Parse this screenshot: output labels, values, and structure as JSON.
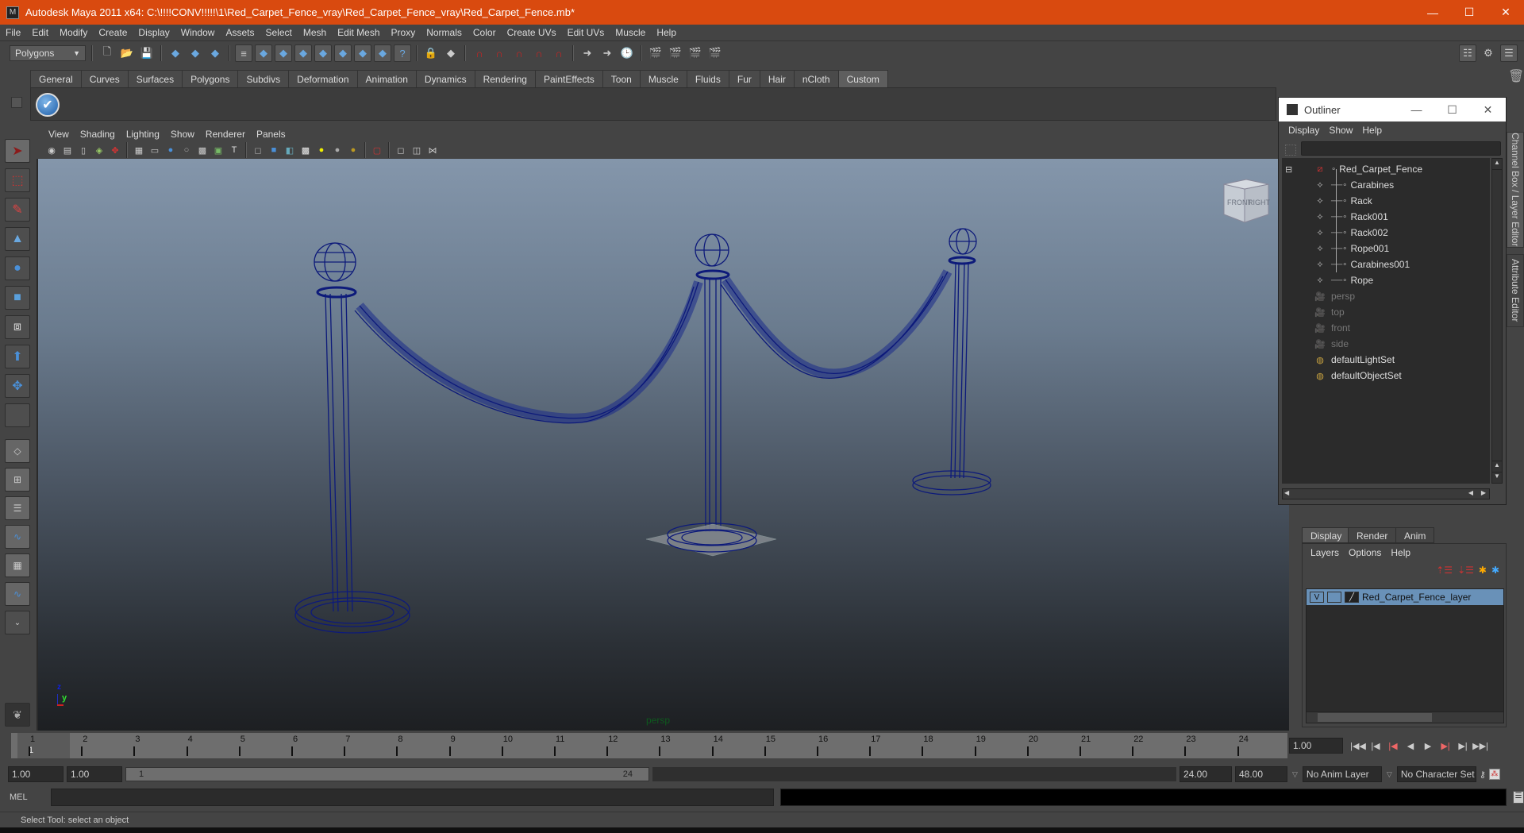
{
  "window": {
    "title": "Autodesk Maya 2011 x64: C:\\!!!!CONV!!!!!\\1\\Red_Carpet_Fence_vray\\Red_Carpet_Fence_vray\\Red_Carpet_Fence.mb*",
    "app_icon": "maya-icon",
    "controls": {
      "minimize": "—",
      "maximize": "☐",
      "close": "✕"
    },
    "title_bar_color": "#d94a0f"
  },
  "menubar": [
    "File",
    "Edit",
    "Modify",
    "Create",
    "Display",
    "Window",
    "Assets",
    "Select",
    "Mesh",
    "Edit Mesh",
    "Proxy",
    "Normals",
    "Color",
    "Create UVs",
    "Edit UVs",
    "Muscle",
    "Help"
  ],
  "statusline": {
    "menu_set": "Polygons",
    "icons": [
      "new-scene-icon",
      "open-scene-icon",
      "save-scene-icon",
      "select-by-hierarchy-icon",
      "select-by-object-icon",
      "select-by-component-icon",
      "mask-menu-icon",
      "select-handles-icon",
      "select-joints-icon",
      "select-curves-icon",
      "select-surfaces-icon",
      "select-deformers-icon",
      "select-dynamics-icon",
      "select-rendering-icon",
      "select-misc-icon",
      "lock-selection-icon",
      "highlight-selection-icon",
      "snap-grid-icon",
      "snap-curve-icon",
      "snap-point-icon",
      "snap-view-plane-icon",
      "snap-live-icon",
      "input-ops-icon",
      "output-ops-icon",
      "construction-history-icon",
      "render-view-icon",
      "render-current-icon",
      "ipr-render-icon",
      "render-settings-icon"
    ],
    "right_icons": [
      "channel-box-toggle-icon",
      "tool-settings-icon",
      "attribute-editor-icon"
    ]
  },
  "shelf": {
    "tabs": [
      "General",
      "Curves",
      "Surfaces",
      "Polygons",
      "Subdivs",
      "Deformation",
      "Animation",
      "Dynamics",
      "Rendering",
      "PaintEffects",
      "Toon",
      "Muscle",
      "Fluids",
      "Fur",
      "Hair",
      "nCloth",
      "Custom"
    ],
    "active_tab": "Custom",
    "items": [
      "checkmark-shelf-icon"
    ],
    "trash_icon": "trash-icon"
  },
  "toolbox": {
    "tools": [
      "select-tool-icon",
      "lasso-tool-icon",
      "paint-select-tool-icon",
      "move-tool-icon",
      "rotate-tool-icon",
      "scale-tool-icon",
      "universal-manipulator-icon",
      "soft-modification-icon",
      "show-manipulator-icon",
      "last-tool-slot"
    ],
    "layouts": [
      "single-perspective-layout-icon",
      "four-view-layout-icon",
      "outliner-persp-layout-icon",
      "persp-graph-layout-icon",
      "hypershade-persp-layout-icon",
      "persp-outliner-graph-layout-icon",
      "more-layouts-icon"
    ],
    "bottom_icon": "maya-logo-icon"
  },
  "viewport": {
    "menu": [
      "View",
      "Shading",
      "Lighting",
      "Show",
      "Renderer",
      "Panels"
    ],
    "icons": [
      "select-camera-icon",
      "camera-attributes-icon",
      "bookmarks-icon",
      "image-plane-icon",
      "two-d-pan-zoom-icon",
      "grid-icon",
      "film-gate-icon",
      "resolution-gate-icon",
      "gate-mask-icon",
      "field-chart-icon",
      "safe-action-icon",
      "safe-title-icon",
      "wireframe-icon",
      "smooth-shade-icon",
      "wireframe-on-shaded-icon",
      "textured-icon",
      "use-all-lights-icon",
      "shadows-icon",
      "screen-space-ao-icon",
      "isolate-select-icon",
      "xray-icon",
      "xray-joints-icon",
      "xray-components-icon"
    ],
    "camera_label": "persp",
    "viewcube": {
      "left_face": "FRONT",
      "right_face": "RIGHT"
    },
    "axis": {
      "z": "z",
      "y": "y"
    },
    "wireframe_color": "#0d1a7a"
  },
  "outliner": {
    "title": "Outliner",
    "menu": [
      "Display",
      "Show",
      "Help"
    ],
    "filter_value": "",
    "items": [
      {
        "label": "Red_Carpet_Fence",
        "icon": "group-transform-icon",
        "level": 0,
        "dim": false,
        "expanded": true
      },
      {
        "label": "Carabines",
        "icon": "mesh-icon",
        "level": 1,
        "dim": false
      },
      {
        "label": "Rack",
        "icon": "mesh-icon",
        "level": 1,
        "dim": false
      },
      {
        "label": "Rack001",
        "icon": "mesh-icon",
        "level": 1,
        "dim": false
      },
      {
        "label": "Rack002",
        "icon": "mesh-icon",
        "level": 1,
        "dim": false
      },
      {
        "label": "Rope001",
        "icon": "mesh-icon",
        "level": 1,
        "dim": false
      },
      {
        "label": "Carabines001",
        "icon": "mesh-icon",
        "level": 1,
        "dim": false
      },
      {
        "label": "Rope",
        "icon": "mesh-icon",
        "level": 1,
        "dim": false
      },
      {
        "label": "persp",
        "icon": "camera-icon",
        "level": 0,
        "dim": true
      },
      {
        "label": "top",
        "icon": "camera-icon",
        "level": 0,
        "dim": true
      },
      {
        "label": "front",
        "icon": "camera-icon",
        "level": 0,
        "dim": true
      },
      {
        "label": "side",
        "icon": "camera-icon",
        "level": 0,
        "dim": true
      },
      {
        "label": "defaultLightSet",
        "icon": "set-icon",
        "level": 0,
        "dim": false
      },
      {
        "label": "defaultObjectSet",
        "icon": "set-icon",
        "level": 0,
        "dim": false
      }
    ]
  },
  "side_tabs": [
    "Channel Box / Layer Editor",
    "Attribute Editor"
  ],
  "layer_editor": {
    "tabs": [
      "Display",
      "Render",
      "Anim"
    ],
    "active_tab": "Display",
    "menu": [
      "Layers",
      "Options",
      "Help"
    ],
    "icons": [
      "move-layer-up-icon",
      "move-layer-down-icon",
      "new-empty-layer-icon",
      "new-layer-from-selected-icon"
    ],
    "layers": [
      {
        "visible": "V",
        "playback": "",
        "display_type": "wireframe",
        "name": "Red_Carpet_Fence_layer",
        "selected": true
      }
    ],
    "selected_color": "#6991b8"
  },
  "timeline": {
    "frames": [
      1,
      2,
      3,
      4,
      5,
      6,
      7,
      8,
      9,
      10,
      11,
      12,
      13,
      14,
      15,
      16,
      17,
      18,
      19,
      20,
      21,
      22,
      23,
      24
    ],
    "current_frame": "1",
    "current_time_field": "1.00",
    "playback_buttons": [
      "go-to-start-icon",
      "step-back-frame-icon",
      "step-back-key-icon",
      "play-backwards-icon",
      "play-forwards-icon",
      "step-forward-key-icon",
      "step-forward-frame-icon",
      "go-to-end-icon"
    ]
  },
  "range": {
    "start_time": "1.00",
    "playback_start": "1.00",
    "slider_start": "1",
    "slider_end": "24",
    "playback_end": "24.00",
    "end_time": "48.00",
    "anim_layer": "No Anim Layer",
    "character_set": "No Character Set",
    "key_icon": "auto-key-icon",
    "prefs_icon": "animation-preferences-icon"
  },
  "command_line": {
    "label": "MEL",
    "input_value": "",
    "result_value": "",
    "script_editor_icon": "script-editor-icon"
  },
  "help_line": "Select Tool: select an object"
}
